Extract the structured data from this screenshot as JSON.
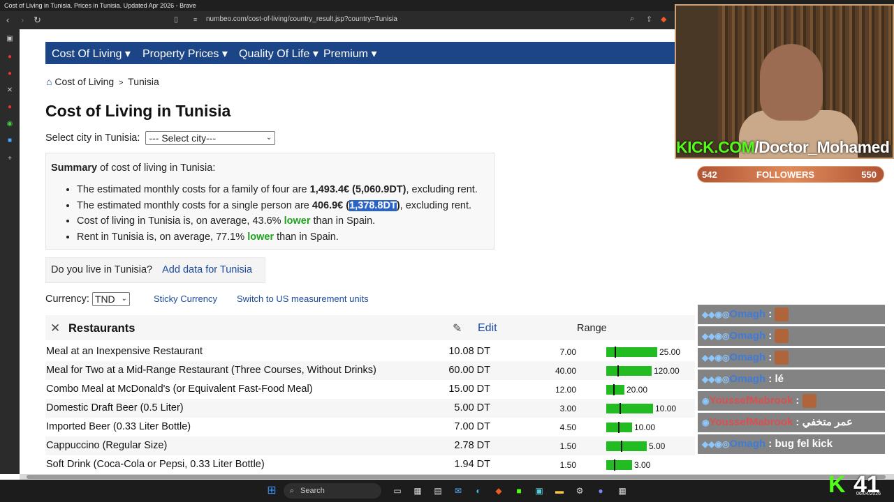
{
  "window": {
    "title": "Cost of Living in Tunisia. Prices in Tunisia. Updated Apr 2026 - Brave"
  },
  "browser": {
    "url": "numbeo.com/cost-of-living/country_result.jsp?country=Tunisia"
  },
  "nav": {
    "items": [
      "Cost Of Living ▾",
      "Property Prices ▾",
      "Quality Of Life ▾",
      "Premium ▾"
    ]
  },
  "breadcrumb": {
    "home": "Cost of Living",
    "sep": ">",
    "current": "Tunisia"
  },
  "page_title": "Cost of Living in Tunisia",
  "city_select": {
    "label": "Select city in Tunisia:",
    "value": "--- Select city---"
  },
  "summary": {
    "heading_bold": "Summary",
    "heading_rest": " of cost of living in Tunisia:",
    "line1_pre": "The estimated monthly costs for a family of four are ",
    "line1_bold": "1,493.4€ (5,060.9DT)",
    "line1_post": ", excluding rent.",
    "line2_pre": "The estimated monthly costs for a single person are ",
    "line2_bold_a": "406.9€ (",
    "line2_selected": "1,378.8DT",
    "line2_bold_b": ")",
    "line2_post": ", excluding rent.",
    "line3_pre": "Cost of living in Tunisia is, on average, 43.6% ",
    "line3_word": "lower",
    "line3_post": " than in Spain.",
    "line4_pre": "Rent in Tunisia is, on average, 77.1% ",
    "line4_word": "lower",
    "line4_post": " than in Spain."
  },
  "live": {
    "question": "Do you live in Tunisia?",
    "link": "Add data for Tunisia"
  },
  "currency": {
    "label": "Currency:",
    "value": "TND",
    "sticky": "Sticky Currency",
    "switch": "Switch to US measurement units"
  },
  "category": {
    "title": "Restaurants",
    "edit": "Edit",
    "range": "Range"
  },
  "rows": [
    {
      "name": "Meal at an Inexpensive Restaurant",
      "price": "10.08 DT",
      "min": "7.00",
      "max": "25.00",
      "bar_fraction": 1.0,
      "marker_fraction": 0.17
    },
    {
      "name": "Meal for Two at a Mid-Range Restaurant (Three Courses, Without Drinks)",
      "price": "60.00 DT",
      "min": "40.00",
      "max": "120.00",
      "bar_fraction": 0.89,
      "marker_fraction": 0.25
    },
    {
      "name": "Combo Meal at McDonald's (or Equivalent Fast-Food Meal)",
      "price": "15.00 DT",
      "min": "12.00",
      "max": "20.00",
      "bar_fraction": 0.36,
      "marker_fraction": 0.38
    },
    {
      "name": "Domestic Draft Beer (0.5 Liter)",
      "price": "5.00 DT",
      "min": "3.00",
      "max": "10.00",
      "bar_fraction": 0.92,
      "marker_fraction": 0.29
    },
    {
      "name": "Imported Beer (0.33 Liter Bottle)",
      "price": "7.00 DT",
      "min": "4.50",
      "max": "10.00",
      "bar_fraction": 0.51,
      "marker_fraction": 0.45
    },
    {
      "name": "Cappuccino (Regular Size)",
      "price": "2.78 DT",
      "min": "1.50",
      "max": "5.00",
      "bar_fraction": 0.8,
      "marker_fraction": 0.37
    },
    {
      "name": "Soft Drink (Coca-Cola or Pepsi, 0.33 Liter Bottle)",
      "price": "1.94 DT",
      "min": "1.50",
      "max": "3.00",
      "bar_fraction": 0.51,
      "marker_fraction": 0.29
    }
  ],
  "stream": {
    "channel_prefix": "KICK.COM",
    "channel_name": "/Doctor_Mohamed",
    "followers_current": "542",
    "followers_label": "FOLLOWERS",
    "followers_goal": "550",
    "clock": "41",
    "date": "06/04/2026"
  },
  "chat": [
    {
      "user": "Omagh",
      "sep": " : ",
      "msg": "",
      "emote": true,
      "type": "o"
    },
    {
      "user": "Omagh",
      "sep": " : ",
      "msg": "",
      "emote": true,
      "type": "o"
    },
    {
      "user": "Omagh",
      "sep": " : ",
      "msg": "",
      "emote": true,
      "type": "o"
    },
    {
      "user": "Omagh",
      "sep": " : ",
      "msg": "lé",
      "emote": false,
      "type": "o"
    },
    {
      "user": "YoussefMabrook",
      "sep": " : ",
      "msg": "",
      "emote": true,
      "type": "y"
    },
    {
      "user": "YoussefMabrook",
      "sep": " : ",
      "msg": "عمر متخفي",
      "emote": false,
      "type": "y"
    },
    {
      "user": "Omagh",
      "sep": " : ",
      "msg": "bug fel kick",
      "emote": false,
      "type": "o"
    }
  ],
  "taskbar": {
    "search": "Search"
  }
}
